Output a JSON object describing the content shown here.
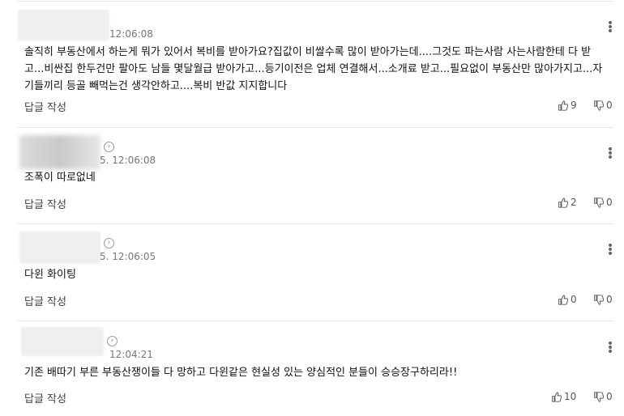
{
  "comments": [
    {
      "timestamp": "12:06:08",
      "text": "솔직히 부동산에서 하는게 뭐가 있어서 복비를 받아가요?집값이 비쌀수록 많이 받아가는데....그것도 파는사람 사는사람한테 다 받고...비싼집 한두건만 팔아도 남들 몇달월급 받아가고...등기이전은 업체 연결해서...소개료 받고...필요없이 부동산만 많아가지고...자기들끼리 등골 빼먹는건 생각안하고....복비 반값 지지합니다",
      "reply_label": "답글 작성",
      "likes": "9",
      "dislikes": "0"
    },
    {
      "timestamp": "5. 12:06:08",
      "text": "조폭이 따로없네",
      "reply_label": "답글 작성",
      "likes": "2",
      "dislikes": "0"
    },
    {
      "timestamp": "5. 12:06:05",
      "text": "다윈 화이팅",
      "reply_label": "답글 작성",
      "likes": "0",
      "dislikes": "0"
    },
    {
      "timestamp": "12:04:21",
      "text": "기존 배따기 부른 부동산쟁이들 다 망하고 다윈같은 현실성 있는 양심적인 분들이 승승장구하리라!!",
      "reply_label": "답글 작성",
      "likes": "10",
      "dislikes": "0"
    }
  ]
}
